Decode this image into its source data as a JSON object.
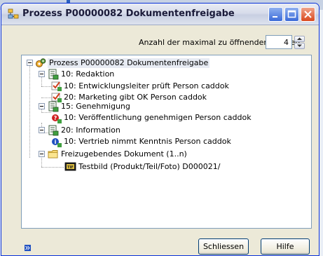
{
  "window": {
    "title": "Prozess P00000082 Dokumentenfreigabe"
  },
  "levels": {
    "label": "Anzahl der maximal zu öffnenden Ebenen",
    "value": "4"
  },
  "tree": {
    "root": {
      "label": "Prozess P00000082 Dokumentenfreigabe",
      "icon": "process-gears-icon"
    },
    "steps": [
      {
        "label": "10: Redaktion",
        "icon": "step-list-icon",
        "tasks": [
          {
            "label": "10: Entwicklungsleiter prüft Person caddok",
            "icon": "task-done-check-icon",
            "status_color": "#d04020"
          },
          {
            "label": "20: Marketing gibt OK Person caddok",
            "icon": "task-done-check-icon",
            "status_color": "#d04020"
          }
        ]
      },
      {
        "label": "15: Genehmigung",
        "icon": "step-list-icon",
        "tasks": [
          {
            "label": "10: Veröffentlichung genehmigen Person caddok",
            "icon": "task-rejected-icon",
            "status_color": "#d02020"
          }
        ]
      },
      {
        "label": "20: Information",
        "icon": "step-list-icon",
        "tasks": [
          {
            "label": "10: Vertrieb nimmt Kenntnis Person caddok",
            "icon": "task-info-icon",
            "status_color": "#2050c0"
          }
        ]
      }
    ],
    "documents": {
      "label": "Freizugebendes Dokument (1..n)",
      "icon": "folder-icon",
      "items": [
        {
          "label": "Testbild (Produkt/Teil/Foto) D000021/",
          "icon": "image-document-icon"
        }
      ]
    }
  },
  "buttons": {
    "close": "Schliessen",
    "help": "Hilfe"
  },
  "colors": {
    "title_bar": "#d7dcea",
    "accent": "#0831d9",
    "close_button": "#d9481d"
  }
}
